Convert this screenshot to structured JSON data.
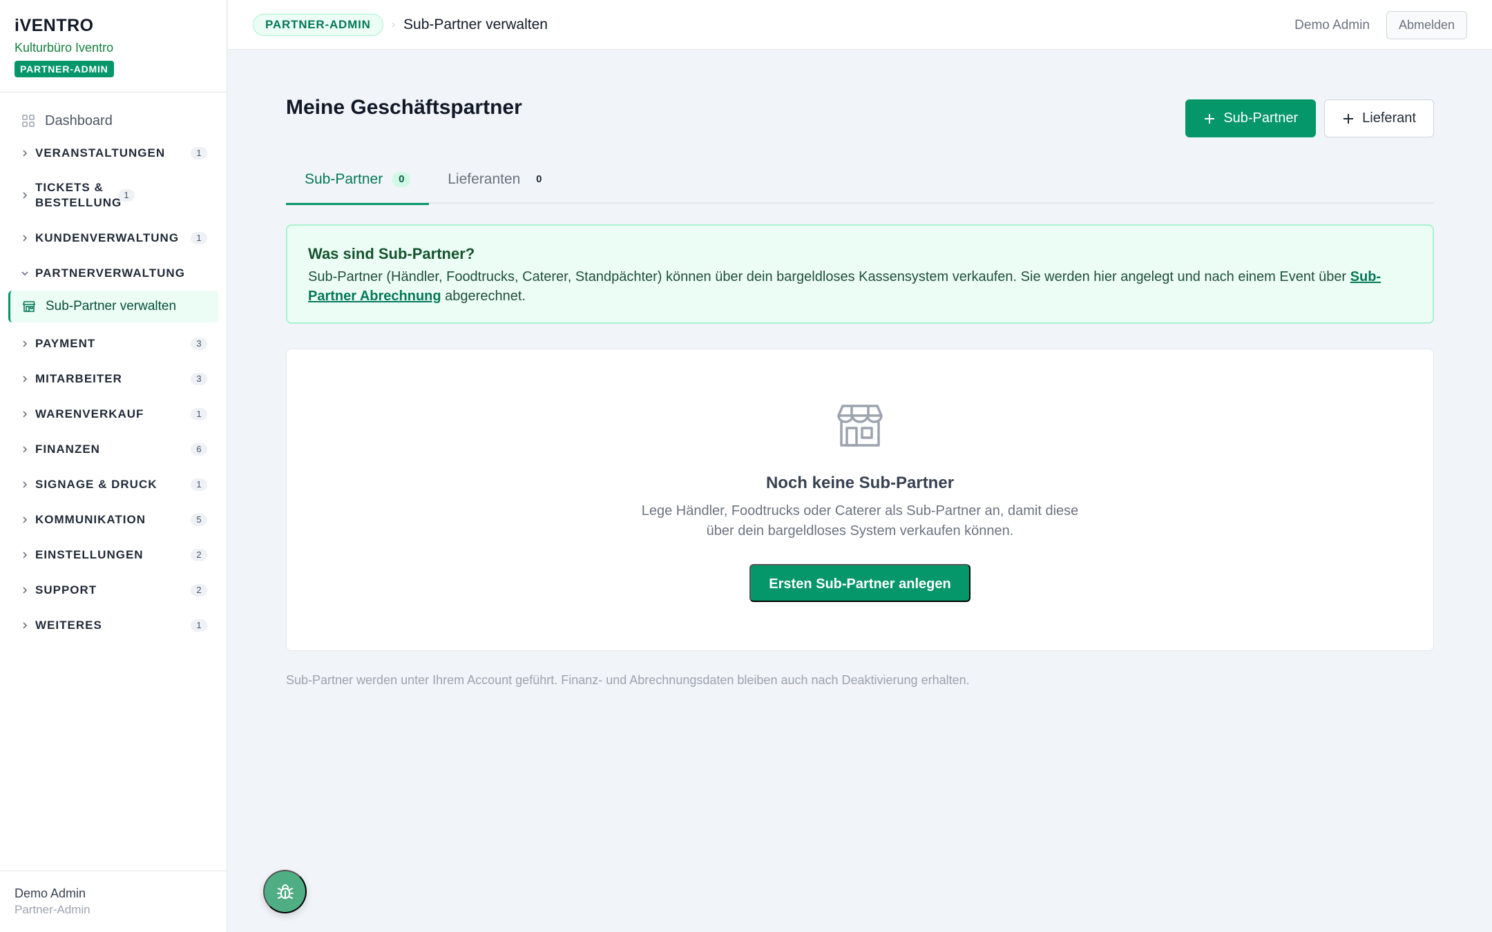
{
  "brand": {
    "name": "iVENTRO",
    "org": "Kulturbüro Iventro",
    "badge": "PARTNER-ADMIN"
  },
  "sidebar": {
    "dashboard": "Dashboard",
    "groups": [
      {
        "label": "VERANSTALTUNGEN",
        "count": "1"
      },
      {
        "label": "TICKETS & BESTELLUNG",
        "count": "1"
      },
      {
        "label": "KUNDENVERWALTUNG",
        "count": "1"
      },
      {
        "label": "PARTNERVERWALTUNG",
        "count": ""
      },
      {
        "label": "PAYMENT",
        "count": "3"
      },
      {
        "label": "MITARBEITER",
        "count": "3"
      },
      {
        "label": "WARENVERKAUF",
        "count": "1"
      },
      {
        "label": "FINANZEN",
        "count": "6"
      },
      {
        "label": "SIGNAGE & DRUCK",
        "count": "1"
      },
      {
        "label": "KOMMUNIKATION",
        "count": "5"
      },
      {
        "label": "EINSTELLUNGEN",
        "count": "2"
      },
      {
        "label": "SUPPORT",
        "count": "2"
      },
      {
        "label": "WEITERES",
        "count": "1"
      }
    ],
    "active_item": "Sub-Partner verwalten",
    "footer": {
      "name": "Demo Admin",
      "role": "Partner-Admin"
    }
  },
  "topbar": {
    "role_pill": "PARTNER-ADMIN",
    "crumb_sep": "›",
    "page": "Sub-Partner verwalten",
    "user": "Demo Admin",
    "logout": "Abmelden"
  },
  "main": {
    "title": "Meine Geschäftspartner",
    "add_subpartner": "Sub-Partner",
    "add_supplier": "Lieferant",
    "tabs": [
      {
        "label": "Sub-Partner",
        "count": "0"
      },
      {
        "label": "Lieferanten",
        "count": "0"
      }
    ],
    "info": {
      "title": "Was sind Sub-Partner?",
      "text_before": "Sub-Partner (Händler, Foodtrucks, Caterer, Standpächter) können über dein bargeldloses Kassensystem verkaufen. Sie werden hier angelegt und nach einem Event über ",
      "link": "Sub-Partner Abrechnung",
      "text_after": " abgerechnet."
    },
    "empty": {
      "title": "Noch keine Sub-Partner",
      "text": "Lege Händler, Foodtrucks oder Caterer als Sub-Partner an, damit diese über dein bargeldloses System verkaufen können.",
      "button": "Ersten Sub-Partner anlegen"
    },
    "note": "Sub-Partner werden unter Ihrem Account geführt. Finanz- und Abrechnungsdaten bleiben auch nach Deaktivierung erhalten."
  },
  "colors": {
    "accent": "#059669",
    "accent_light": "#ecfdf5"
  }
}
